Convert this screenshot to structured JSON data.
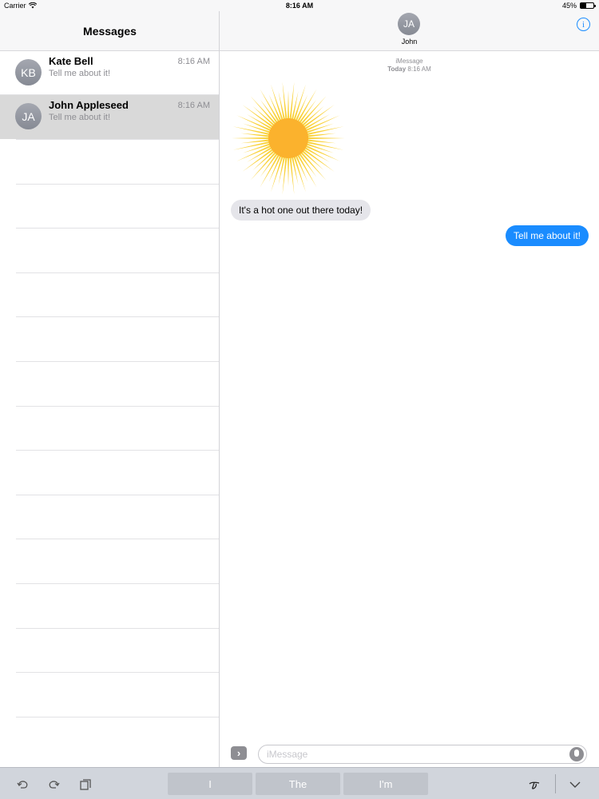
{
  "status_bar": {
    "carrier": "Carrier",
    "time": "8:16 AM",
    "battery": "45%",
    "battery_level": 0.45
  },
  "sidebar": {
    "title": "Messages",
    "conversations": [
      {
        "initials": "KB",
        "name": "Kate Bell",
        "time": "8:16 AM",
        "preview": "Tell me about it!"
      },
      {
        "initials": "JA",
        "name": "John Appleseed",
        "time": "8:16 AM",
        "preview": "Tell me about it!"
      }
    ]
  },
  "chat": {
    "contact_initials": "JA",
    "contact_name": "John",
    "service": "iMessage",
    "date_label": "Today",
    "date_time": "8:16 AM",
    "messages": [
      {
        "direction": "incoming",
        "text": "It's a hot one out there today!"
      },
      {
        "direction": "outgoing",
        "text": "Tell me about it!"
      }
    ],
    "input_placeholder": "iMessage"
  },
  "keyboard_bar": {
    "suggestions": [
      "I",
      "The",
      "I'm"
    ]
  },
  "colors": {
    "accent": "#1a8cff",
    "incoming_bubble": "#e5e5ea",
    "sun_rays": "#f9d23c",
    "sun_core": "#fbb22d"
  }
}
